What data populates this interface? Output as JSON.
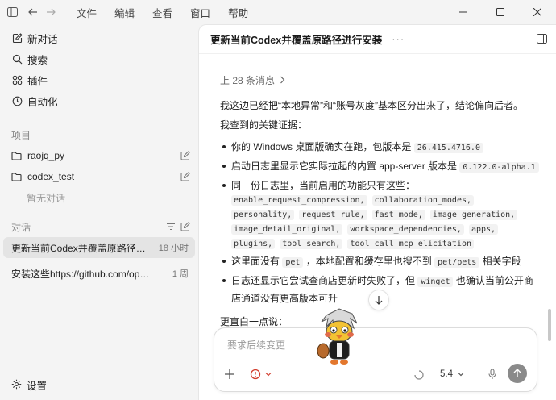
{
  "menu": [
    "文件",
    "编辑",
    "查看",
    "窗口",
    "帮助"
  ],
  "sidebar": {
    "nav": [
      {
        "label": "新对话",
        "icon": "new-chat-icon"
      },
      {
        "label": "搜索",
        "icon": "search-icon"
      },
      {
        "label": "插件",
        "icon": "plugins-icon"
      },
      {
        "label": "自动化",
        "icon": "clock-icon"
      }
    ],
    "projects_title": "项目",
    "projects": [
      {
        "label": "raojq_py"
      },
      {
        "label": "codex_test"
      }
    ],
    "projects_empty": "暂无对话",
    "conversations_title": "对话",
    "conversations": [
      {
        "label": "更新当前Codex并覆盖原路径进行安装",
        "time": "18 小时"
      },
      {
        "label": "安装这些https://github.com/openai/plugins",
        "time": "1 周"
      }
    ],
    "settings_label": "设置"
  },
  "main": {
    "title": "更新当前Codex并覆盖原路径进行安装",
    "more": "···",
    "prev_messages": "上 28 条消息",
    "intro": "我这边已经把“本地异常”和“账号灰度”基本区分出来了，结论偏向后者。",
    "evidence_title": "我查到的关键证据：",
    "bullets": {
      "b1_text": "你的 Windows 桌面版确实在跑，包版本是",
      "b1_code": "26.415.4716.0",
      "b2_text": "启动日志里显示它实际拉起的内置 app-server 版本是",
      "b2_code": "0.122.0-alpha.1",
      "b3_text": "同一份日志里，当前启用的功能只有这些：",
      "b3_codes": [
        "enable_request_compression,",
        "collaboration_modes,",
        "personality,",
        "request_rule,",
        "fast_mode,",
        "image_generation,",
        "image_detail_original,",
        "workspace_dependencies,",
        "apps,",
        "plugins,",
        "tool_search,",
        "tool_call_mcp_elicitation"
      ],
      "b4_pre": "这里面没有",
      "b4_code1": "pet",
      "b4_mid": "，本地配置和缓存里也搜不到",
      "b4_code2": "pet/pets",
      "b4_post": "相关字段",
      "b5_pre": "日志还显示它尝试查商店更新时失败了，但",
      "b5_code": "winget",
      "b5_post": "也确认当前公开商店通道没有更高版本可升"
    },
    "tldr": "更直白一点说："
  },
  "composer": {
    "placeholder": "要求后续变更",
    "model": "5.4"
  }
}
